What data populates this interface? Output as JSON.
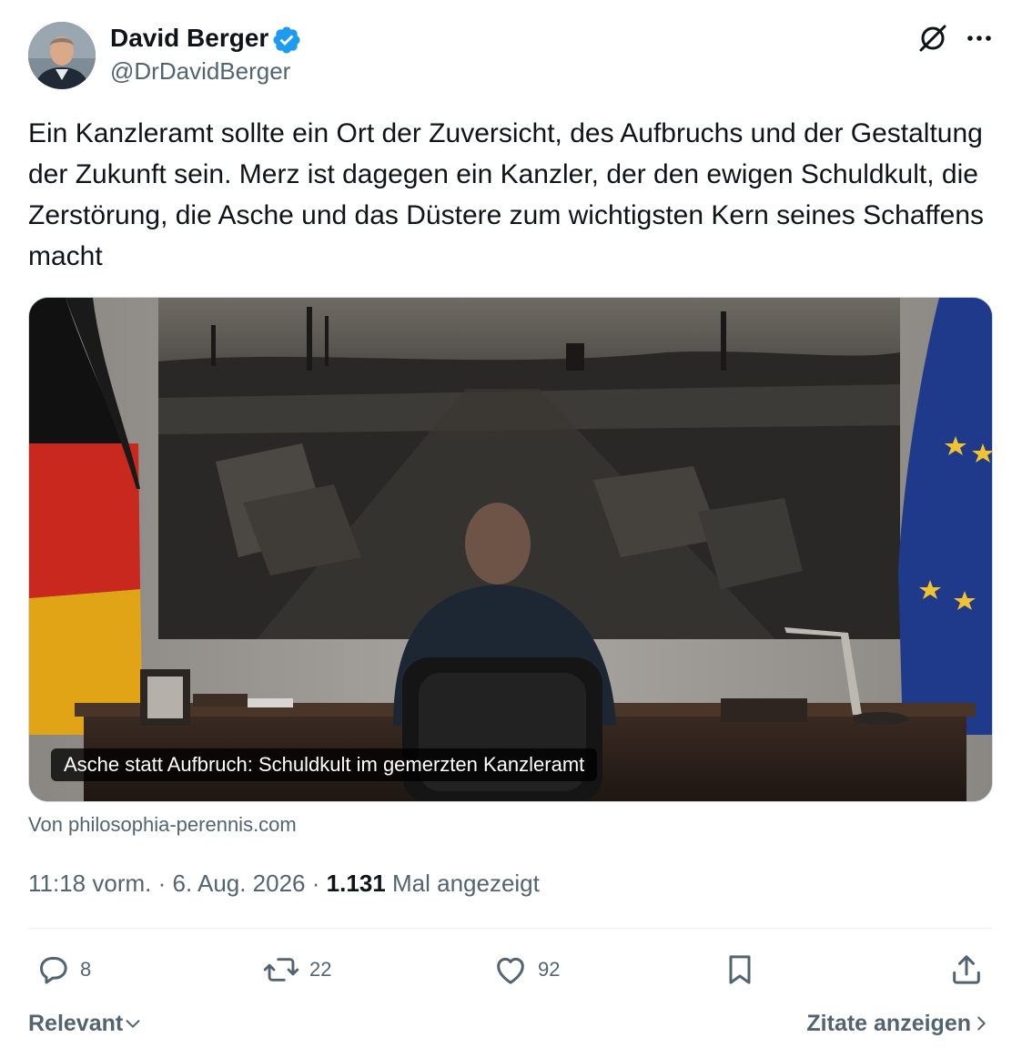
{
  "author": {
    "name": "David Berger",
    "handle": "@DrDavidBerger",
    "verified": true
  },
  "tweet": {
    "text": "Ein Kanzleramt sollte ein Ort der Zuversicht, des Aufbruchs und der Gestaltung der Zukunft sein. Merz ist dagegen ein Kanzler, der den ewigen Schuldkult, die Zerstörung, die Asche und das Düstere zum wichtigsten Kern seines Schaffens macht"
  },
  "link_card": {
    "caption": "Asche statt Aufbruch: Schuldkult im gemerzten Kanzleramt",
    "source": "Von philosophia-perennis.com"
  },
  "meta": {
    "time": "11:18 vorm.",
    "date": "6. Aug. 2026",
    "separator": "·",
    "views_count": "1.131",
    "views_label": "Mal angezeigt"
  },
  "actions": {
    "replies": "8",
    "reposts": "22",
    "likes": "92"
  },
  "footer": {
    "sort_label": "Relevant",
    "quotes_label": "Zitate anzeigen"
  },
  "icons": [
    "verified-badge-icon",
    "grok-icon",
    "more-icon",
    "reply-icon",
    "repost-icon",
    "like-icon",
    "bookmark-icon",
    "share-icon",
    "chevron-down-icon",
    "chevron-right-icon"
  ],
  "colors": {
    "text_primary": "#0f1419",
    "text_secondary": "#536471",
    "verified_blue": "#1d9bf0",
    "border": "#cfd9de"
  }
}
